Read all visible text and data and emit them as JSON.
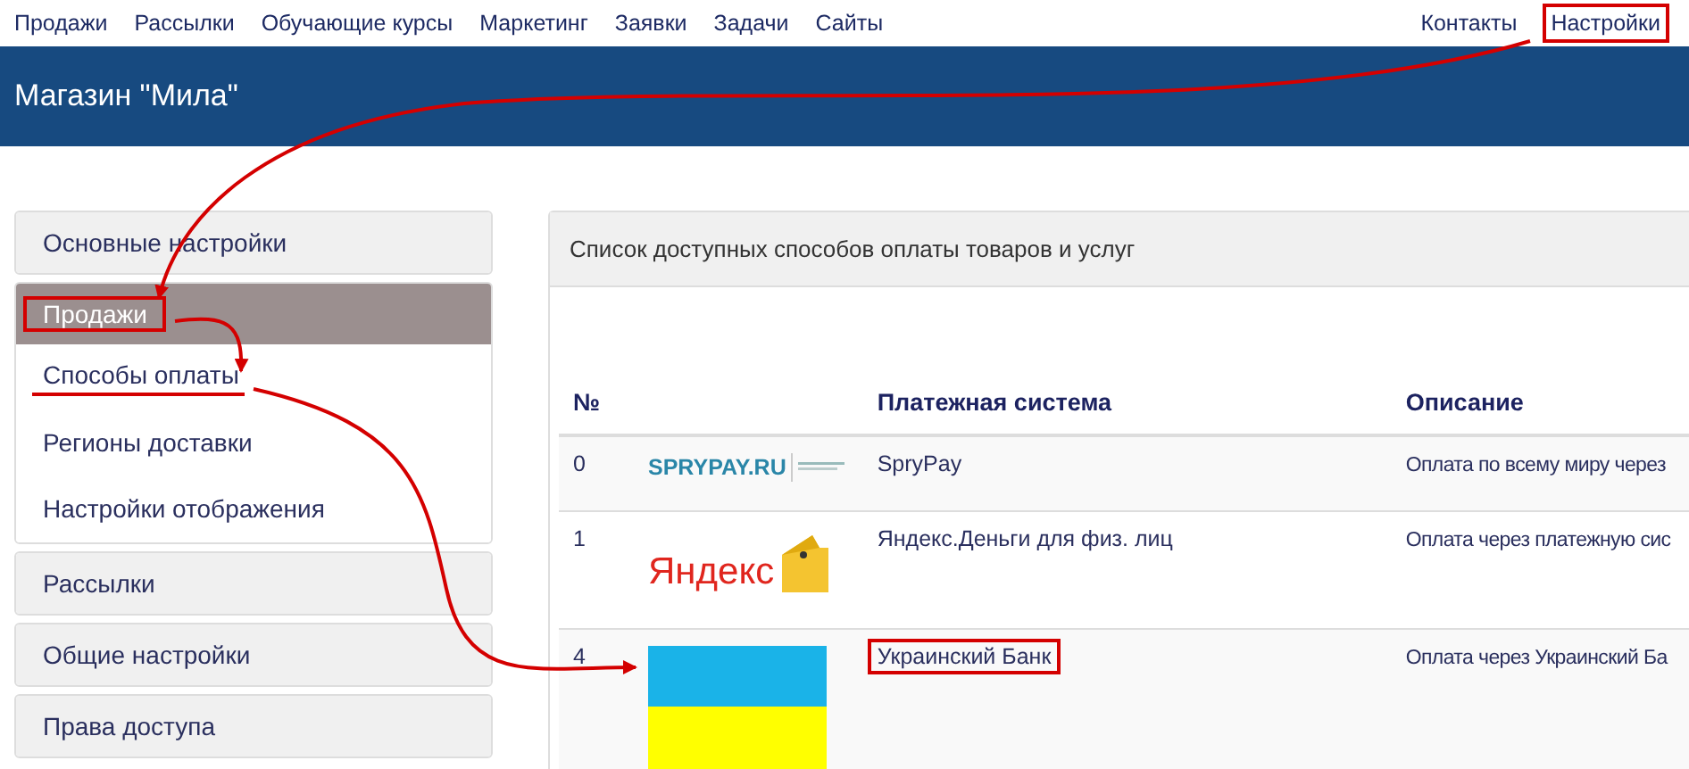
{
  "top_nav": {
    "items": [
      {
        "label": "Продажи",
        "highlighted": false
      },
      {
        "label": "Рассылки",
        "highlighted": false
      },
      {
        "label": "Обучающие курсы",
        "highlighted": false
      },
      {
        "label": "Маркетинг",
        "highlighted": false
      },
      {
        "label": "Заявки",
        "highlighted": false
      },
      {
        "label": "Задачи",
        "highlighted": false
      },
      {
        "label": "Сайты",
        "highlighted": false
      }
    ],
    "right_items": [
      {
        "label": "Контакты",
        "highlighted": false
      },
      {
        "label": "Настройки",
        "highlighted": true
      }
    ]
  },
  "header": {
    "title": "Магазин \"Мила\""
  },
  "sidebar": {
    "sections": [
      {
        "label": "Основные настройки",
        "expanded": false,
        "highlighted": false
      },
      {
        "label": "Продажи",
        "expanded": true,
        "highlighted": true,
        "children": [
          {
            "label": "Способы оплаты",
            "underlined": true
          },
          {
            "label": "Регионы доставки",
            "underlined": false
          },
          {
            "label": "Настройки отображения",
            "underlined": false
          }
        ]
      },
      {
        "label": "Рассылки",
        "expanded": false,
        "highlighted": false
      },
      {
        "label": "Общие настройки",
        "expanded": false,
        "highlighted": false
      },
      {
        "label": "Права доступа",
        "expanded": false,
        "highlighted": false
      }
    ]
  },
  "payments_panel": {
    "title": "Список доступных способов оплаты товаров и услуг",
    "table": {
      "columns": [
        {
          "label": "№"
        },
        {
          "label": "Платежная система"
        },
        {
          "label": "Описание"
        }
      ],
      "rows": [
        {
          "number": "0",
          "logo": {
            "kind": "sprypay",
            "text": "SPRYPAY.RU"
          },
          "system": "SpryPay",
          "highlighted": false,
          "description": "Оплата по всему миру через"
        },
        {
          "number": "1",
          "logo": {
            "kind": "yandex",
            "text": "Яндекс"
          },
          "system": "Яндекс.Деньги для физ. лиц",
          "highlighted": false,
          "description": "Оплата через платежную сис"
        },
        {
          "number": "4",
          "logo": {
            "kind": "flag"
          },
          "system": "Украинский Банк",
          "highlighted": true,
          "description": "Оплата через Украинский Ба"
        }
      ]
    }
  }
}
